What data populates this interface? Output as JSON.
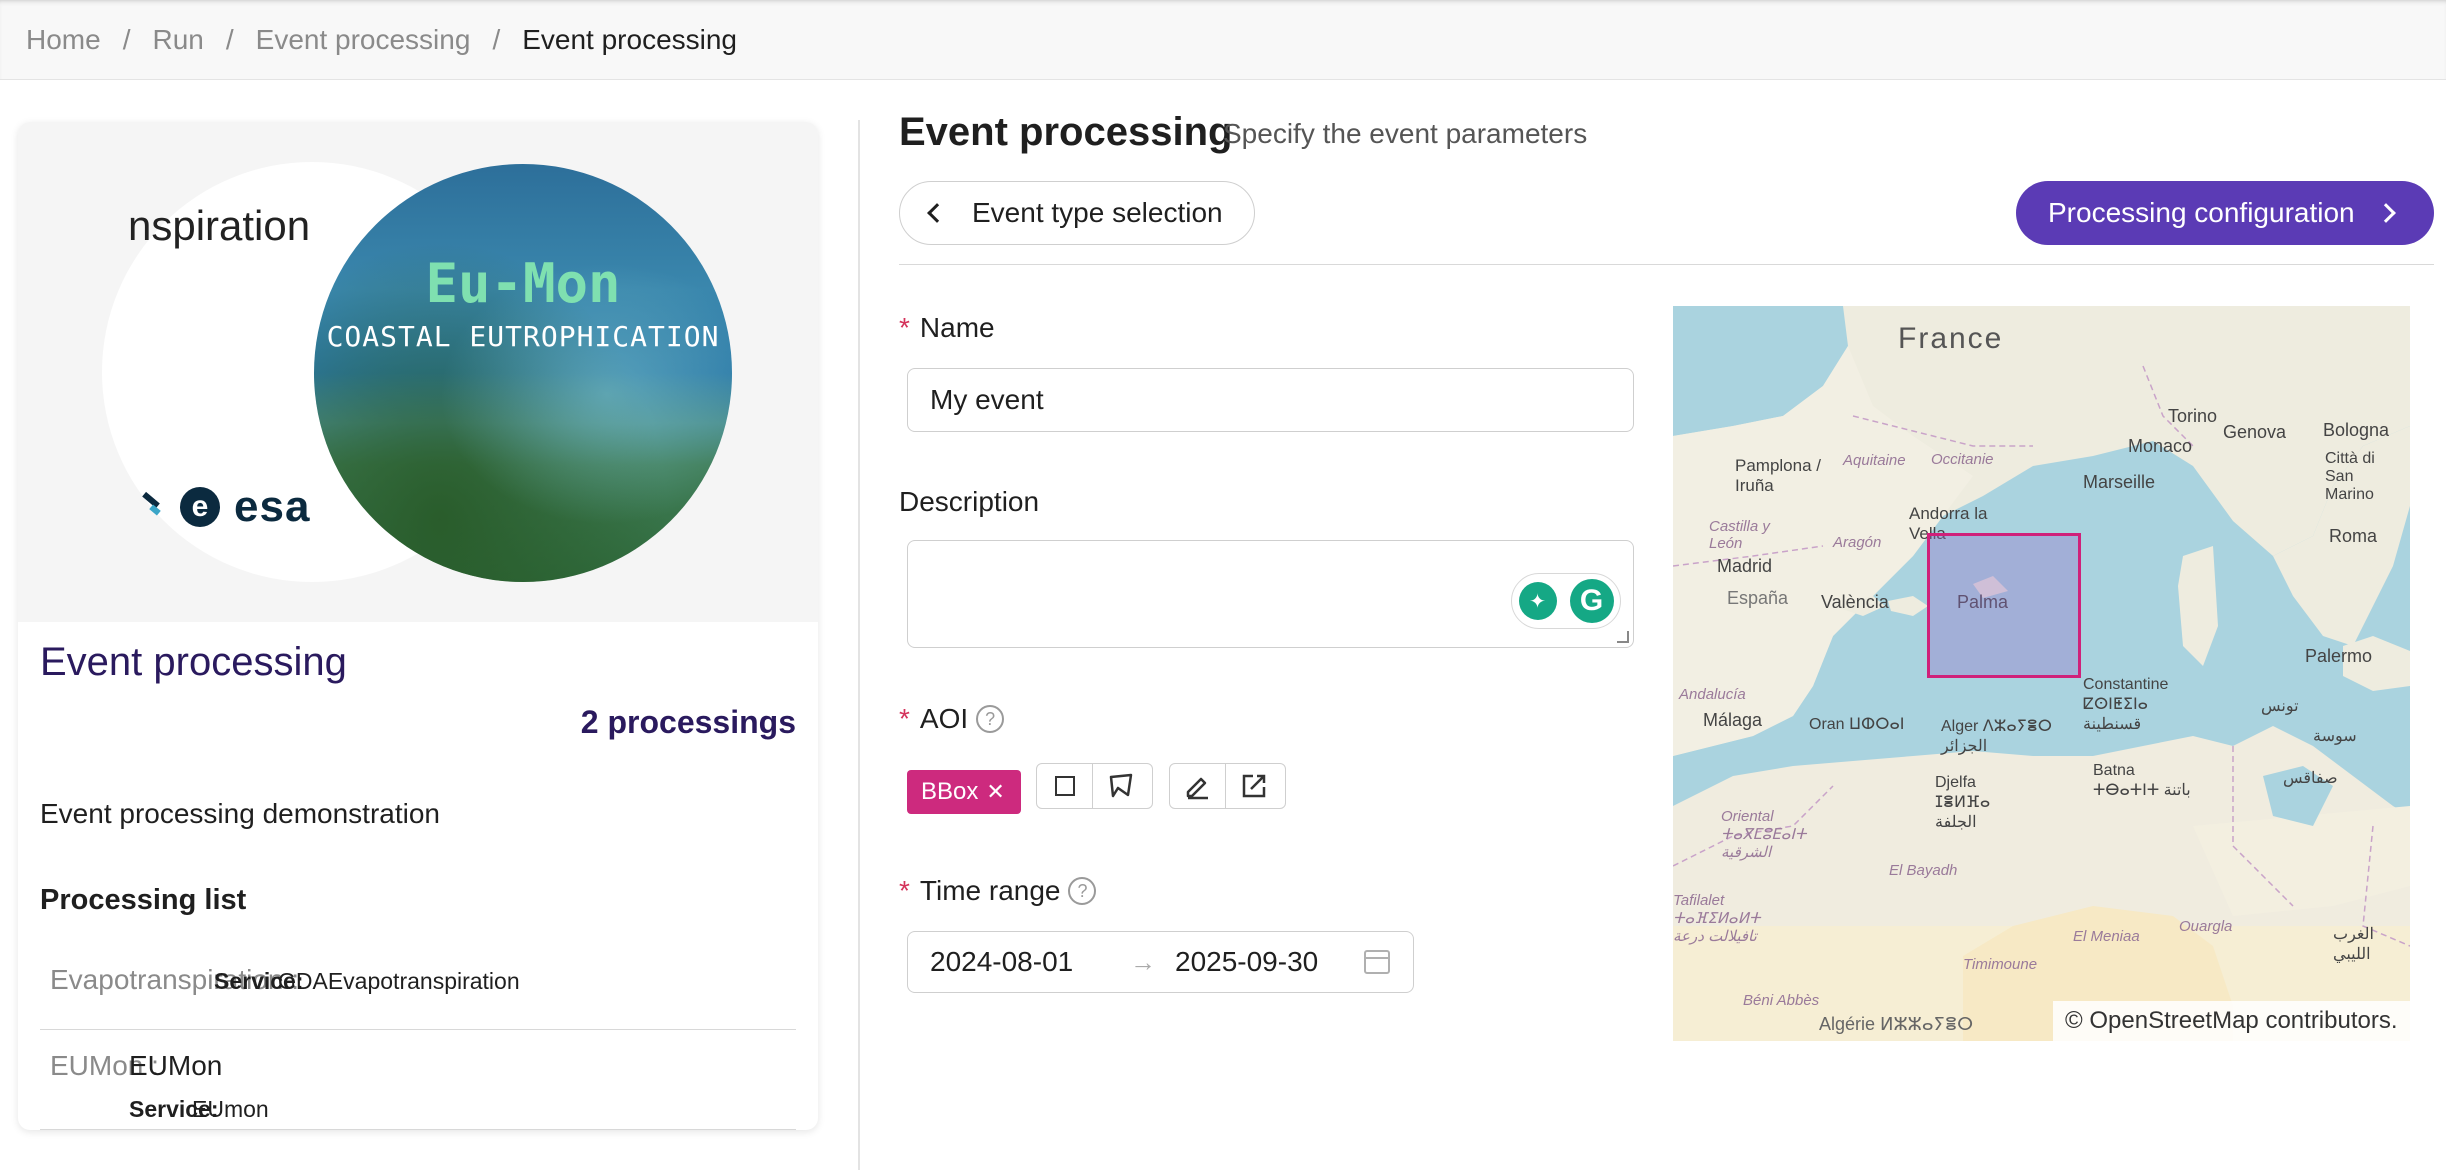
{
  "breadcrumb": [
    "Home",
    "Run",
    "Event processing",
    "Event processing"
  ],
  "card": {
    "cover_text": "nspiration",
    "cover_photo_title": "Eu-Mon",
    "cover_photo_subtitle": "COASTAL EUTROPHICATION",
    "cover_logo_text": "esa",
    "cover_logo_letter": "e",
    "title": "Event processing",
    "processings_count": "2 processings",
    "description": "Event processing demonstration",
    "list_title": "Processing list",
    "processings": [
      {
        "name": "Evapotranspiration",
        "value": "",
        "service_label": "Service:",
        "service": "GDAEvapotranspiration"
      },
      {
        "name": "EUMon",
        "value": "EUMon",
        "service_label": "Service:",
        "service": "EUmon"
      }
    ]
  },
  "main": {
    "title": "Event processing",
    "subtitle": "Specify the event parameters",
    "back_button": "Event type selection",
    "next_button": "Processing configuration",
    "form": {
      "name_label": "Name",
      "name_value": "My event",
      "description_label": "Description",
      "description_value": "",
      "aoi_label": "AOI",
      "aoi_tag": "BBox",
      "time_range_label": "Time range",
      "date_start": "2024-08-01",
      "date_end": "2025-09-30",
      "help_glyph": "?",
      "required_mark": "*"
    }
  },
  "map": {
    "labels": {
      "france": "France",
      "aquitaine": "Aquitaine",
      "occitanie": "Occitanie",
      "torino": "Torino",
      "genova": "Genova",
      "bologna": "Bologna",
      "monaco": "Monaco",
      "citta": "Città di San Marino",
      "pamplona": "Pamplona / Iruña",
      "marseille": "Marseille",
      "andorra": "Andorra la Vella",
      "aragon": "Aragón",
      "castilla": "Castilla y León",
      "roma": "Roma",
      "madrid": "Madrid",
      "espana": "España",
      "valencia": "València",
      "palma": "Palma",
      "andalucia": "Andalucía",
      "malaga": "Málaga",
      "oran": "Oran ⵡⵀⵔⴰⵏ",
      "alger": "Alger ⴷⵣⴰⵢⴻⵔ الجزائر",
      "constantine": "Constantine ⵇⵙⵏⵟⵉⵏⴰ قسنطينة",
      "palermo": "Palermo",
      "batna": "Batna ⵜⴱⴰⵜⵏⵜ باتنة",
      "djelfa": "Djelfa ⵊⴻⵍⴼⴰ الجلفة",
      "oriental": "Oriental ⵜⴰⴳⵎⵓⴹⴰⵏⵜ الشرقية",
      "elbayadh": "El Bayadh",
      "tafilalet": "Tafilalet ⵜⴰⴼⵉⵍⴰⵍⵜ تافيلالت درعة",
      "timimoune": "Timimoune",
      "elmeniaa": "El Meniaa",
      "ouargla": "Ouargla",
      "beniabbes": "Béni Abbès",
      "algerie": "Algérie ⵍⵣⵣⴰⵢⴻⵔ",
      "tunis": "تونس",
      "sousse": "سوسة",
      "sfax": "صفاقس",
      "tunisie": "تونس",
      "libya": "الغرب الليبي"
    },
    "attribution": "© OpenStreetMap contributors."
  },
  "colors": {
    "primary": "#5b3bb5",
    "tag": "#cd2a7e",
    "title": "#2a1a5e",
    "required": "#d4335b"
  }
}
